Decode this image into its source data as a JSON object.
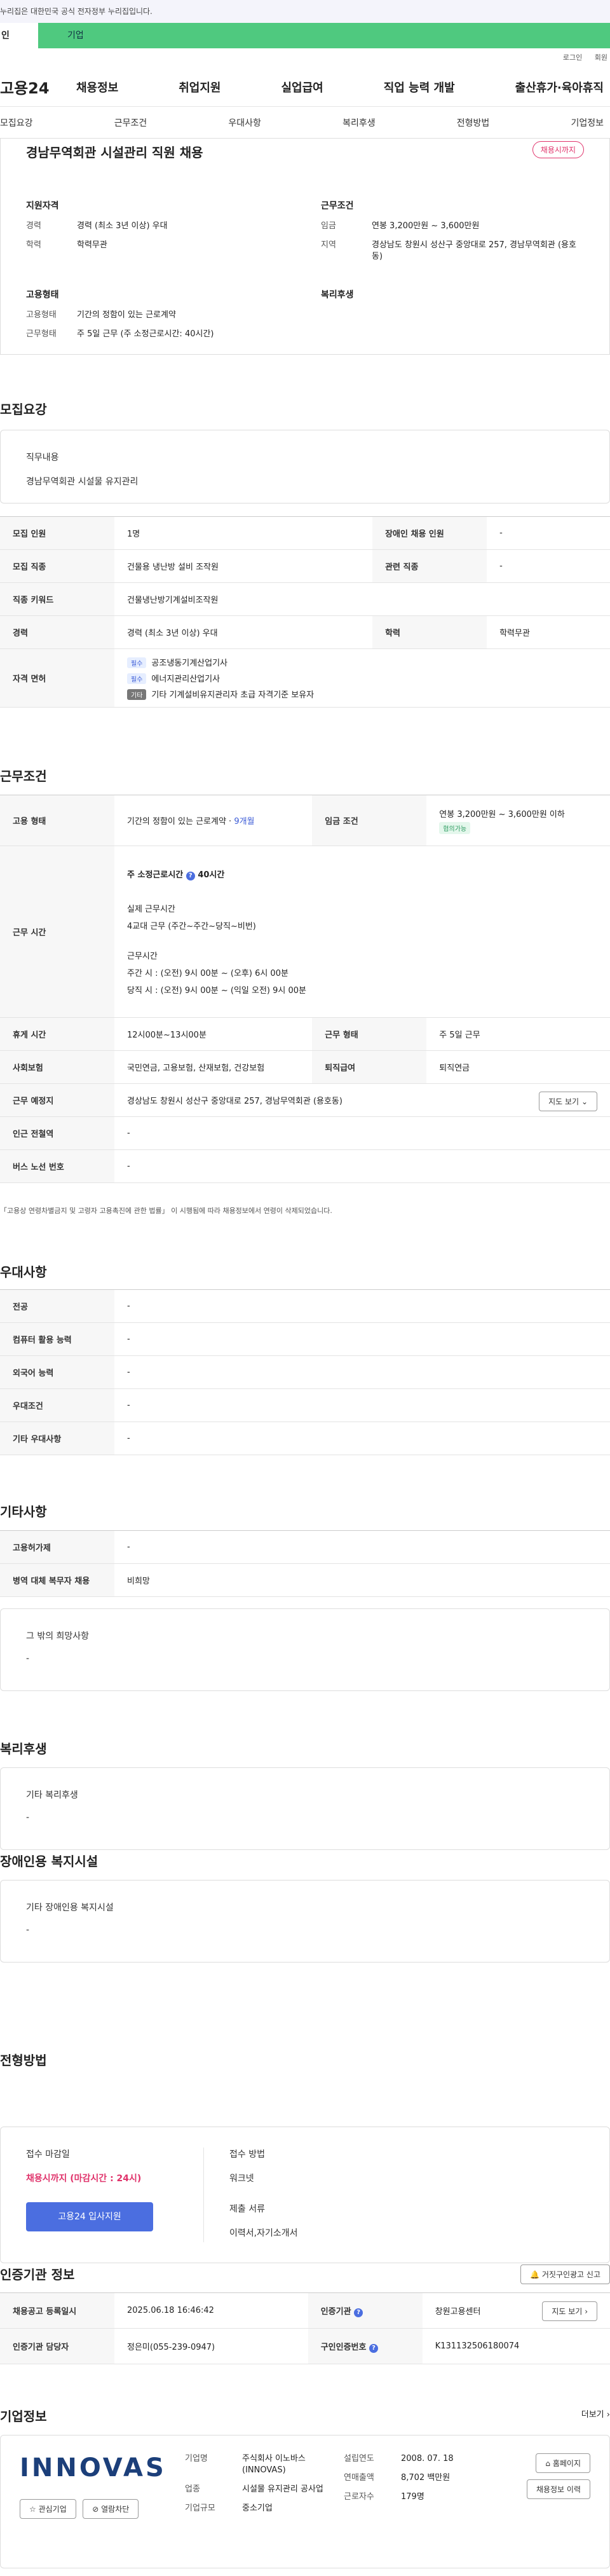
{
  "gov_banner": "누리집은 대한민국 공식 전자정부 누리집입니다.",
  "type_tabs": {
    "personal": "인",
    "corp": "기업"
  },
  "util_links": [
    "로그인",
    "회원"
  ],
  "logo": "고용24",
  "gnb": [
    "채용정보",
    "취업지원",
    "실업급여",
    "직업 능력 개발",
    "출산휴가·육아휴직"
  ],
  "anchor_tabs": [
    "모집요강",
    "근무조건",
    "우대사항",
    "복리후생",
    "전형방법",
    "기업정보"
  ],
  "summary": {
    "title": "경남무역회관 시설관리 직원 채용",
    "badge": "채용시까지",
    "qual_title": "지원자격",
    "career_k": "경력",
    "career_v": "경력 (최소 3년 이상) 우대",
    "edu_k": "학력",
    "edu_v": "학력무관",
    "cond_title": "근무조건",
    "wage_k": "임금",
    "wage_v": "연봉 3,200만원 ~ 3,600만원",
    "area_k": "지역",
    "area_v": "경상남도 창원시 성산구 중앙대로 257, 경남무역회관 (용호동)",
    "emp_title": "고용형태",
    "emptype_k": "고용형태",
    "emptype_v": "기간의 정함이 있는 근로계약",
    "worktype_k": "근무형태",
    "worktype_v": "주 5일 근무 (주 소정근로시간: 40시간)",
    "welfare_title": "복리후생"
  },
  "recruit": {
    "title": "모집요강",
    "duty_k": "직무내용",
    "duty_v": "경남무역회관 시설물 유지관리",
    "rows": {
      "headcount_k": "모집 인원",
      "headcount_v": "1명",
      "disabled_k": "장애인 채용 인원",
      "disabled_v": "-",
      "job_k": "모집 직종",
      "job_v": "건물용 냉난방 설비 조작원",
      "related_k": "관련 직종",
      "related_v": "-",
      "keyword_k": "직종 키워드",
      "keyword_v": "건물냉난방기계설비조작원",
      "career_k": "경력",
      "career_v": "경력 (최소 3년 이상) 우대",
      "edu_k": "학력",
      "edu_v": "학력무관",
      "license_k": "자격 면허",
      "lic1_tag": "필수",
      "lic1": "공조냉동기계산업기사",
      "lic2_tag": "필수",
      "lic2": "에너지관리산업기사",
      "lic3_tag": "기타",
      "lic3": "기타 기계설비유지관리자 초급 자격기준 보유자"
    }
  },
  "workcond": {
    "title": "근무조건",
    "emp_k": "고용 형태",
    "emp_v": "기간의 정함이 있는 근로계약 · ",
    "emp_link": "9개월",
    "wage_k": "임금 조건",
    "wage_v": "연봉 3,200만원 ~ 3,600만원 이하",
    "wage_tag": "협의가능",
    "time_k": "근무 시간",
    "time_head": "주 소정근로시간",
    "time_head_v": "40시간",
    "time_l1": "실제 근무시간",
    "time_l2": "4교대 근무 (주간~주간~당직~비번)",
    "time_l3": "근무시간",
    "time_l4": "주간 시 : (오전) 9시 00분 ~ (오후) 6시 00분",
    "time_l5": "당직 시 : (오전) 9시 00분 ~ (익일 오전) 9시 00분",
    "rest_k": "휴게 시간",
    "rest_v": "12시00분~13시00분",
    "form_k": "근무 형태",
    "form_v": "주 5일 근무",
    "ins_k": "사회보험",
    "ins_v": "국민연금, 고용보험, 산재보험, 건강보험",
    "ret_k": "퇴직급여",
    "ret_v": "퇴직연금",
    "place_k": "근무 예정지",
    "place_v": "경상남도 창원시 성산구 중앙대로 257, 경남무역회관 (용호동)",
    "map_btn": "지도 보기",
    "subway_k": "인근 전철역",
    "subway_v": "-",
    "bus_k": "버스 노선 번호",
    "bus_v": "-",
    "note": "「고용상 연령차별금지 및 고령자 고용촉진에 관한 법률」 이 시행됨에 따라 채용정보에서 연령이 삭제되었습니다."
  },
  "pref": {
    "title": "우대사항",
    "major_k": "전공",
    "major_v": "-",
    "pc_k": "컴퓨터 활용 능력",
    "pc_v": "-",
    "lang_k": "외국어 능력",
    "lang_v": "-",
    "cond_k": "우대조건",
    "cond_v": "-",
    "etc_k": "기타 우대사항",
    "etc_v": "-"
  },
  "other": {
    "title": "기타사항",
    "sub_k": "고용허가제",
    "sub_v": "-",
    "mil_k": "병역 대체 복무자 채용",
    "mil_v": "비희망",
    "etc_title": "그 밖의 희망사항",
    "etc_v": "-"
  },
  "welfare": {
    "title": "복리후생",
    "box_title": "기타 복리후생",
    "box_v": "-"
  },
  "disabled": {
    "title": "장애인용 복지시설",
    "box_title": "기타 장애인용 복지시설",
    "box_v": "-"
  },
  "process": {
    "title": "전형방법",
    "deadline_k": "접수 마감일",
    "deadline_v": "채용시까지 (마감시간 : 24시)",
    "apply_btn": "고용24 입사지원",
    "method_k": "접수 방법",
    "method_v": "워크넷",
    "docs_k": "제출 서류",
    "docs_v": "이력서,자기소개서"
  },
  "cert": {
    "title": "인증기관 정보",
    "report_btn": "거짓구인광고 신고",
    "reg_k": "채용공고 등록일시",
    "reg_v": "2025.06.18 16:46:42",
    "org_k": "인증기관",
    "org_v": "창원고용센터",
    "map_btn": "지도 보기",
    "mgr_k": "인증기관 담당자",
    "mgr_v": "정은미(055-239-0947)",
    "no_k": "구인인증번호",
    "no_v": "K131132506180074"
  },
  "company": {
    "title": "기업정보",
    "more": "더보기",
    "logo_text": "INNOVAS",
    "fav_btn": "관심기업",
    "block_btn": "열람차단",
    "name_k": "기업명",
    "name_v": "주식회사 이노바스(INNOVAS)",
    "biz_k": "업종",
    "biz_v": "시설물 유지관리 공사업",
    "size_k": "기업규모",
    "size_v": "중소기업",
    "est_k": "설립연도",
    "est_v": "2008. 07. 18",
    "sales_k": "연매출액",
    "sales_v": "8,702 백만원",
    "emp_k": "근로자수",
    "emp_v": "179명",
    "home_btn": "홈페이지",
    "jobs_btn": "채용정보 이력"
  },
  "colors": {
    "accent_green": "#4fc97f",
    "accent_blue": "#4b6ee0",
    "badge_red": "#e0336b"
  }
}
